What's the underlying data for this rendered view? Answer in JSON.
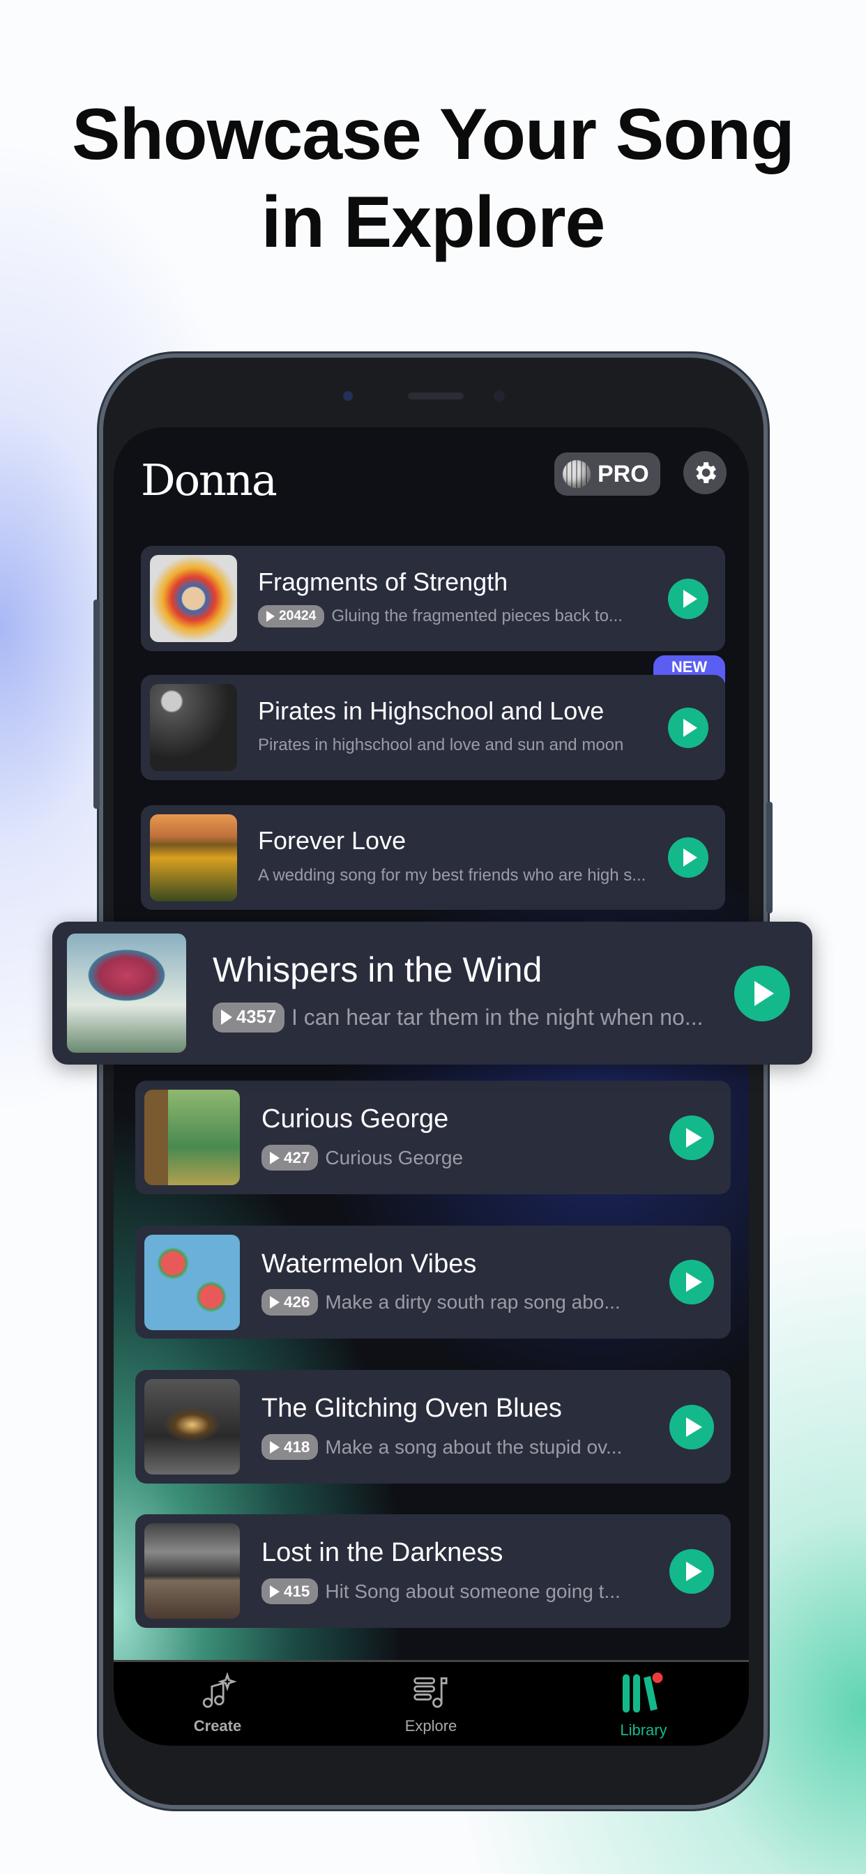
{
  "headline": {
    "line1": "Showcase Your Song",
    "line2": "in Explore"
  },
  "app": {
    "logo": "Donna",
    "pro_label": "PRO",
    "pro_icon": "disco-ball-icon",
    "settings_icon": "gear-icon",
    "accent": "#14b98b",
    "new_badge_color": "#5a5ef2"
  },
  "songs": [
    {
      "title": "Fragments of Strength",
      "plays": "20424",
      "desc": "Gluing the fragmented pieces back to..."
    },
    {
      "title": "Pirates in Highschool and Love",
      "plays": "",
      "desc": "Pirates in highschool and love and sun and moon",
      "badge": "NEW"
    },
    {
      "title": "Forever Love",
      "plays": "",
      "desc": "A wedding song for my best friends who are high s..."
    },
    {
      "title": "Whispers in the Wind",
      "plays": "4357",
      "desc": "I can hear tar them in the night when no..."
    },
    {
      "title": "Curious George",
      "plays": "427",
      "desc": "Curious George"
    },
    {
      "title": "Watermelon Vibes",
      "plays": "426",
      "desc": "Make a dirty south rap song abo..."
    },
    {
      "title": "The Glitching Oven Blues",
      "plays": "418",
      "desc": "Make a song about the stupid ov..."
    },
    {
      "title": "Lost in the Darkness",
      "plays": "415",
      "desc": "Hit Song about someone going t..."
    }
  ],
  "nav": [
    {
      "label": "Create",
      "icon": "music-sparkle-icon"
    },
    {
      "label": "Explore",
      "icon": "list-music-icon"
    },
    {
      "label": "Library",
      "icon": "library-icon",
      "active": true
    }
  ]
}
